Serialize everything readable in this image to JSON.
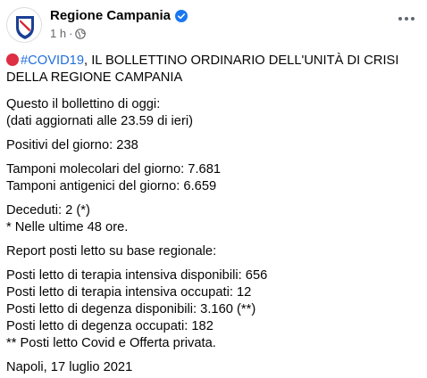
{
  "header": {
    "page_name": "Regione Campania",
    "time": "1 h",
    "separator": "·",
    "verified_icon": "verified-badge-icon",
    "audience_icon": "globe-icon",
    "more_icon": "more-options-icon"
  },
  "post": {
    "headline_icon": "red-circle-emoji",
    "hashtag": "#COVID19",
    "headline_text": ", IL BOLLETTINO ORDINARIO DELL'UNITÀ DI CRISI DELLA REGIONE CAMPANIA",
    "paragraphs": [
      [
        "Questo il bollettino di oggi:",
        "(dati aggiornati alle 23.59 di ieri)"
      ],
      [
        "Positivi del giorno: 238"
      ],
      [
        "Tamponi molecolari del giorno: 7.681",
        "Tamponi antigenici del giorno: 6.659"
      ],
      [
        "Deceduti: 2 (*)",
        "* Nelle ultime 48 ore."
      ],
      [
        "Report posti letto su base regionale:"
      ],
      [
        "Posti letto di terapia intensiva disponibili: 656",
        "Posti letto di terapia intensiva occupati: 12",
        "Posti letto di degenza disponibili: 3.160 (**)",
        "Posti letto di degenza occupati: 182",
        "** Posti letto Covid e Offerta privata."
      ],
      [
        "Napoli, 17 luglio 2021"
      ]
    ]
  },
  "colors": {
    "text": "#050505",
    "secondary": "#65676b",
    "link": "#216fdb",
    "verified": "#1877f2",
    "emblem_blue": "#1a3f93",
    "emblem_red": "#d8232a"
  }
}
